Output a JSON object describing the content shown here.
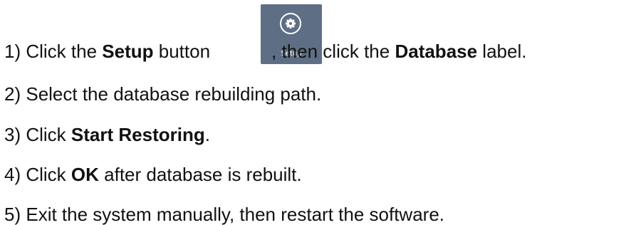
{
  "steps": [
    {
      "number": "1)",
      "text_a": " Click the ",
      "bold_a": "Setup",
      "text_b": " button",
      "text_c": ", then click the ",
      "bold_b": "Database",
      "text_d": " label."
    },
    {
      "number": "2)",
      "text_a": " Select the database rebuilding path."
    },
    {
      "number": "3)",
      "text_a": " Click ",
      "bold_a": "Start Restoring",
      "text_b": "."
    },
    {
      "number": "4)",
      "text_a": " Click ",
      "bold_a": "OK",
      "text_b": " after database is rebuilt."
    },
    {
      "number": "5)",
      "text_a": " Exit the system manually, then restart the software."
    }
  ],
  "setup_button": {
    "label": "Setup",
    "icon": "gear-icon",
    "background": "#5e6f85",
    "foreground": "#ffffff"
  }
}
